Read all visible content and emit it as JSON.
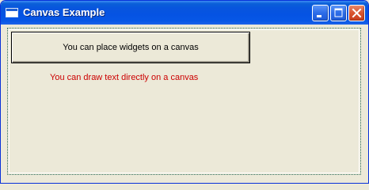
{
  "window": {
    "title": "Canvas Example",
    "icon": "window-icon",
    "controls": {
      "minimize": "minimize-icon",
      "maximize": "maximize-icon",
      "close": "close-icon"
    }
  },
  "canvas": {
    "button_label": "You can place widgets on a canvas",
    "text": "You can draw text directly on a canvas",
    "text_color": "#CC0000"
  },
  "colors": {
    "titlebar": "#0855DD",
    "background": "#ECE9D8",
    "close_button": "#D9542F"
  }
}
